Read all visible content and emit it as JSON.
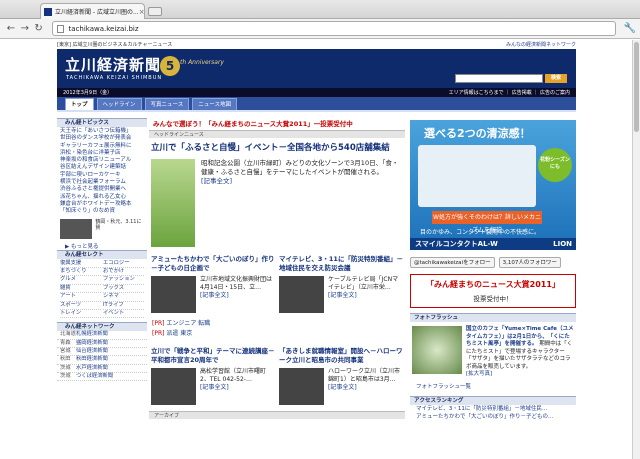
{
  "browser": {
    "tab_title": "立川経済新聞 - 広域立川圏の...",
    "url": "tachikawa.keizai.biz"
  },
  "site": {
    "top_left": "[東京] 広域立川圏のビジネス＆カルチャーニュース",
    "top_right": "みんなの経済新聞ネットワーク",
    "logo": "立川経済新聞",
    "logo_sub": "TACHIKAWA KEIZAI SHIMBUN",
    "anniv_num": "5",
    "anniv_text": "th Anniversary",
    "search_btn": "検索",
    "date": "2012年3月9日（金）",
    "datebar_right": "エリア情報はこちらまで ｜ 広告掲載 ｜ 広告のご案内",
    "tabs": [
      "トップ",
      "ヘッドライン",
      "写真ニュース",
      "ニュース地図"
    ]
  },
  "left": {
    "topics_head": "みん経トピックス",
    "topics": [
      "天王寺に「あいさつ伝箱機」",
      "世田谷のダンス学校が発表会",
      "ギャラリーカフェ展示無料に",
      "浜松・染色台に洋菓子店",
      "神楽坂の和食店リニューアル",
      "谷区結えんデザイン建築話",
      "宇部に喫いローカケーキ",
      "横浜で社会起業フォーラム",
      "渋谷ふるさと権提供開業へ",
      "派花ちゃん、揺れる乙女心",
      "鎌倉台がホワイトデー攻略本",
      "「知床ぐり」のなめ資"
    ],
    "thumb_caption": "鶴岡・秋元、3.11に賛",
    "more": "もっと見る",
    "select_head": "みん経セレクト",
    "select": [
      "復興支援",
      "エコロジー",
      "まちづくり",
      "おでかけ",
      "グルメ",
      "ファッション",
      "雑貨",
      "ブックス",
      "アート",
      "シネマ",
      "スポーツ",
      "ITライフ",
      "トレイン",
      "イベント"
    ],
    "network_head": "みん経ネットワーク",
    "network": [
      {
        "area": "北海道",
        "name": "札幌経済新聞"
      },
      {
        "area": "青森",
        "name": "盛岡経済新聞"
      },
      {
        "area": "宮城",
        "name": "仙台経済新聞"
      },
      {
        "area": "秋田",
        "name": "秋田経済新聞"
      },
      {
        "area": "茨城",
        "name": "水戸経済新聞"
      },
      {
        "area": "茨城",
        "name": "つくば経済新聞"
      }
    ]
  },
  "main": {
    "vote": "みんなで選ぼう！「みん経まちのニュース大賞2011」一投票受付中",
    "headline_head": "ヘッドラインニュース",
    "top_title": "立川で「ふるさと自慢」イベント－全国各地から540店舗集結",
    "top_text": "昭和記念公園（立川市緑町）みどりの文化ゾーンで3月10日、「食・健康・ふるさと自慢」をテーマにしたイベントが開催される。",
    "more_link": "[記事全文]",
    "a1_title": "アミューたちかわで「大ごいのぼり」作り－子どもの日企画で",
    "a1_text": "立川市地域文化振興財団は4月14日・15日、立…",
    "a2_title": "マイテレビ、3・11に「防災特別番組」－地域住民を交え防災会議",
    "a2_text": "ケーブルテレビ局「JCNマイテレビ」（立川市栄…",
    "pr1_label": "[PR]",
    "pr1_text": "エンジニア 転職",
    "pr2_label": "[PR]",
    "pr2_text": "派遣 東京",
    "a3_title": "立川で「戦争と平和」テーマに連続講座－平和都市宣言20周年で",
    "a3_text": "高松学習館（立川市曙町2、TEL 042-52-…",
    "a4_title": "「あきしま就職情報室」開設へ－ハローワーク立川と昭島市の共同事業",
    "a4_text": "ハローワーク立川（立川市錦町1）と昭島市は3月…",
    "archive_head": "アーカイブ"
  },
  "right": {
    "ad_title": "選べる2つの清涼感！",
    "ad_circle": "花粉シーズンにも",
    "ad_tag": "W処方が強くそのわけは？詳しいメカニズムを解説",
    "ad_sub": "目のかゆみ、コンタクト装用中の不快感に。",
    "ad_brand": "スマイルコンタクトAL-W",
    "ad_maker": "LION",
    "follow_btn": "@tachikawakeizaiをフォロー",
    "followers": "3,107人のフォロワー",
    "award_title": "「みん経まちのニュース大賞2011」",
    "award_sub": "投票受付中！",
    "flash_head": "フォトフラッシュ",
    "flash_text_a": "国立のカフェ「Yume×Time Cafe（ユメタイムカフェ）」は2月1日から、「くにたちミスト風亭」を開催する。",
    "flash_text_b": "期間中は「くにたちミスト」で登場するキャラクター「サザタ」を描いたサザタラテなどのコラボ商品を販売しています。",
    "flash_link": "[拡大写真]",
    "flash_list": "フォトフラッシュ一覧",
    "ranking_head": "アクセスランキング",
    "ranking": [
      "マイテレビ、3・11に「防災特別番組」－地域住民…",
      "アミューたちかわで「大ごいのぼり」作り－子どもの…"
    ]
  }
}
